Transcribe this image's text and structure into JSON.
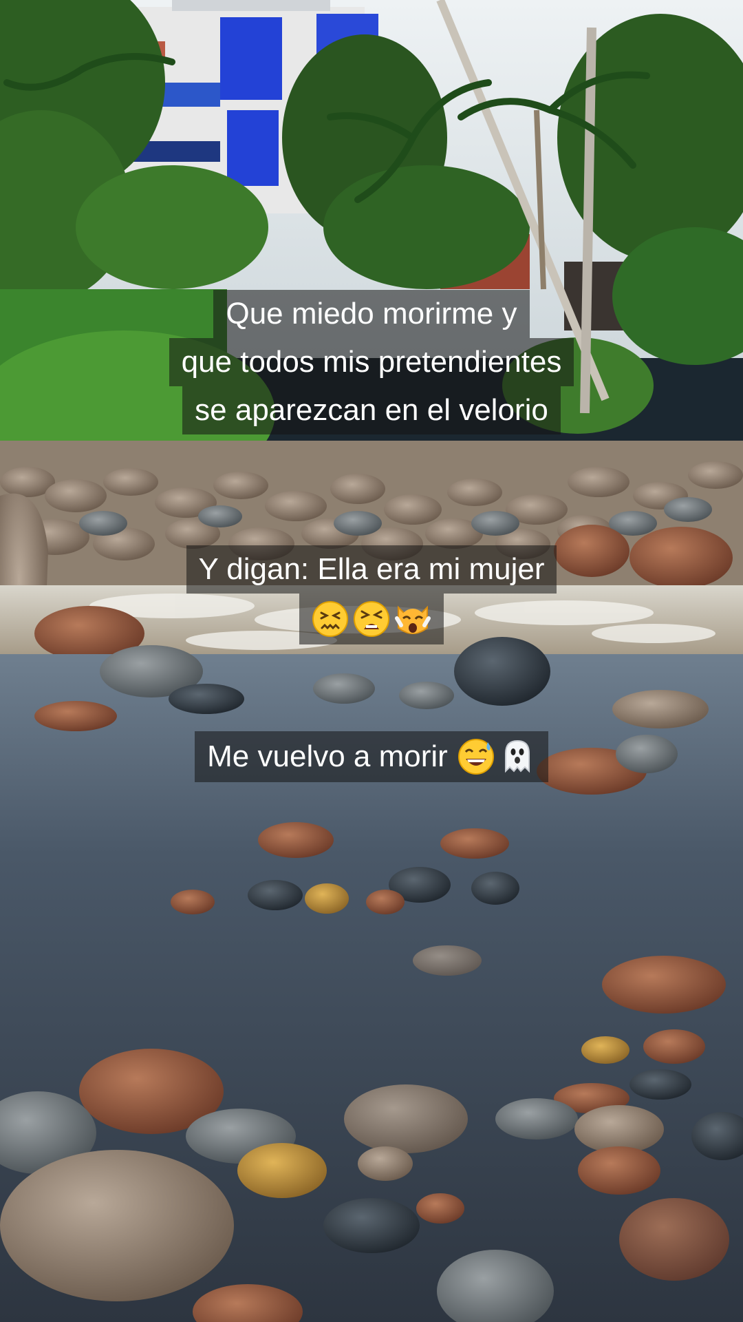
{
  "captions": {
    "first": {
      "line1": "Que miedo morirme y",
      "line2": "que todos mis pretendientes",
      "line3": "se aparezcan en el velorio"
    },
    "second": {
      "line1": "Y digan: Ella era mi mujer",
      "emojis": [
        "confounded-face",
        "tired-face",
        "weary-cat-face"
      ]
    },
    "third": {
      "text": "Me vuelvo a morir",
      "emojis": [
        "grinning-face-with-sweat",
        "ghost"
      ]
    }
  },
  "colors": {
    "caption_bg": "#141414",
    "caption_text": "#ffffff",
    "sky": "#dfe6ea",
    "building_blue": "#1f3fd0",
    "foliage": "#2f7a2a",
    "water": "#3b4a5c"
  }
}
